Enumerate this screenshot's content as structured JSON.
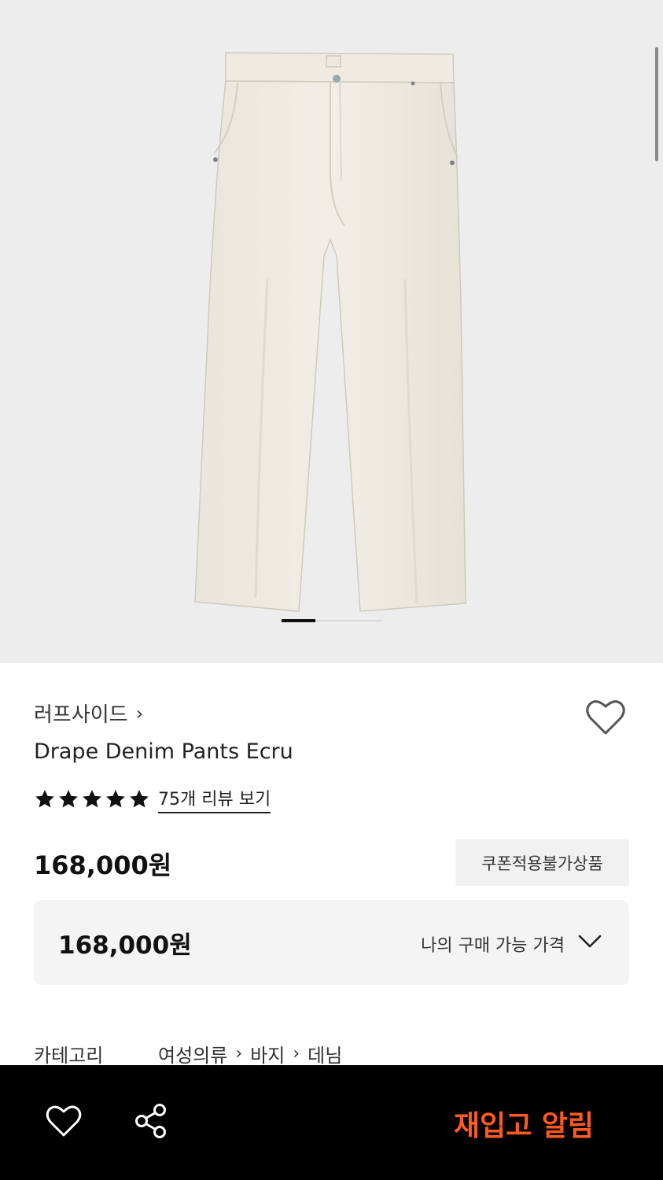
{
  "brand": {
    "name": "러프사이드",
    "chevron": "›"
  },
  "product": {
    "title": "Drape Denim Pants Ecru",
    "image_icon": "product-photo-pants"
  },
  "rating": {
    "stars": 5,
    "review_link": "75개 리뷰 보기"
  },
  "pricing": {
    "price": "168,000원",
    "coupon_badge": "쿠폰적용불가상품",
    "my_price_value": "168,000원",
    "my_price_label": "나의 구매 가능 가격"
  },
  "category": {
    "label": "카테고리",
    "path": [
      "여성의류",
      "바지",
      "데님"
    ],
    "separator": "›"
  },
  "bottom_bar": {
    "restock_label": "재입고 알림",
    "accent_color": "#ff5a1f"
  },
  "colors": {
    "hero_bg": "#ededed",
    "price_box_bg": "#f4f4f4"
  }
}
